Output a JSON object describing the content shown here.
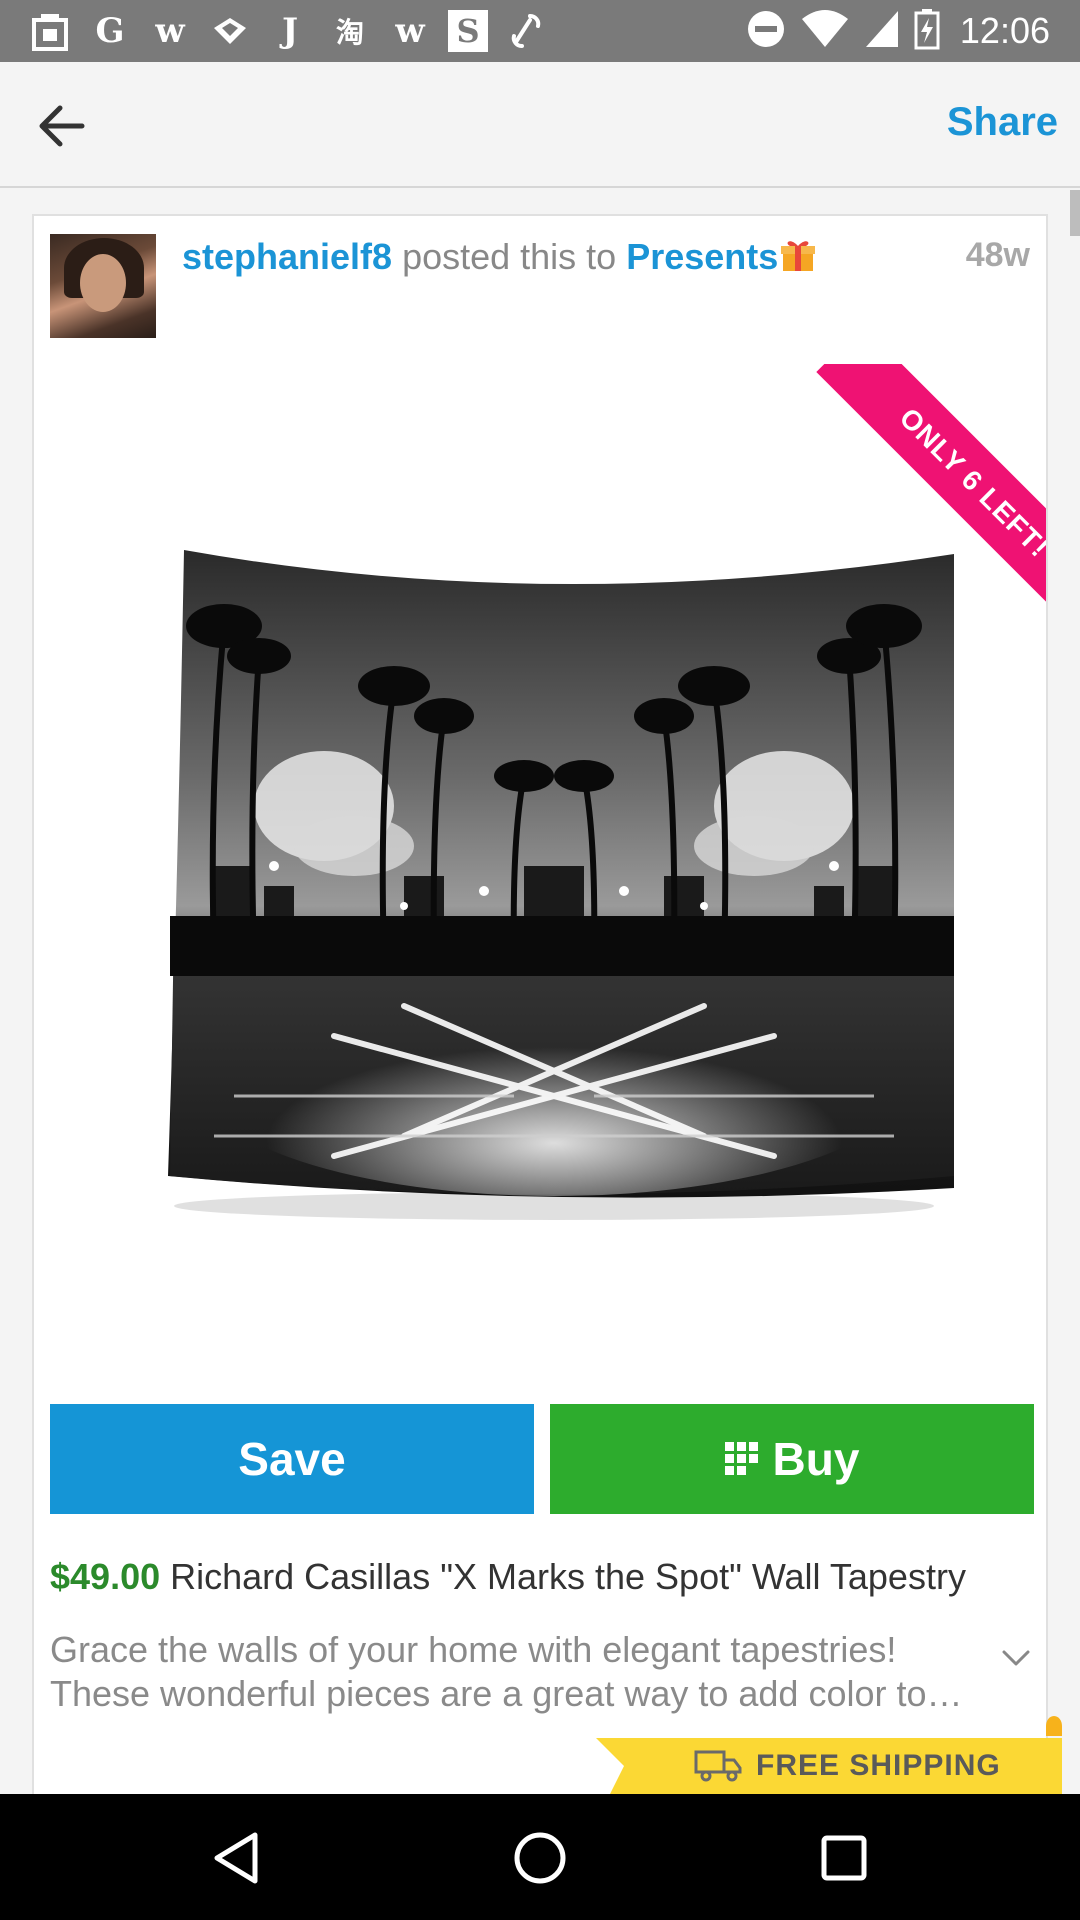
{
  "status_bar": {
    "time": "12:06",
    "notification_icons": [
      "bag-icon",
      "google-icon",
      "w-app-icon",
      "ribbon-icon",
      "j-app-icon",
      "taobao-icon",
      "w-app-icon",
      "s-app-icon",
      "link-icon"
    ],
    "system_icons": [
      "do-not-disturb-icon",
      "wifi-icon",
      "signal-icon",
      "battery-charging-icon"
    ],
    "letters": {
      "g": "G",
      "w1": "w",
      "j": "J",
      "tao": "淘",
      "w2": "w",
      "s": "S"
    }
  },
  "app_bar": {
    "share_label": "Share"
  },
  "post": {
    "username": "stephanielf8",
    "posted_text": " posted this to ",
    "collection": "Presents",
    "age": "48w",
    "ribbon_text": "ONLY 6 LEFT!"
  },
  "actions": {
    "save_label": "Save",
    "buy_label": "Buy"
  },
  "product": {
    "price": "$49.00",
    "title": " Richard Casillas \"X Marks the Spot\" Wall Tapestry",
    "description_line1": "Grace the walls of your home with elegant tapestries!",
    "description_line2": "These wonderful pieces are a great way to add color to …"
  },
  "shipping": {
    "label": "FREE SHIPPING"
  },
  "colors": {
    "accent_blue": "#1b94d6",
    "buy_green": "#2dac2d",
    "ribbon_pink": "#ef1273",
    "price_green": "#2b8a2b",
    "shipping_yellow": "#fbd834"
  }
}
